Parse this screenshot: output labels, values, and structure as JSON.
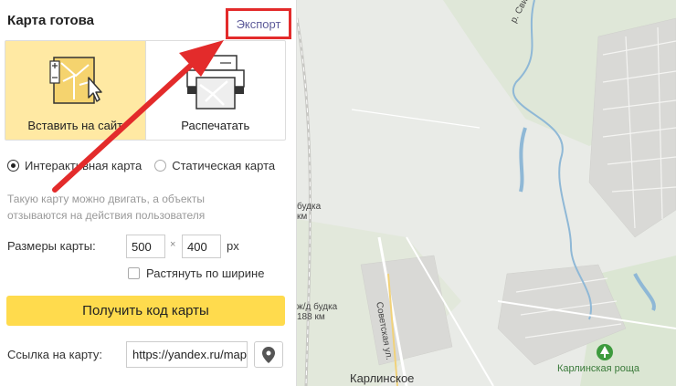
{
  "panel": {
    "title": "Карта готова",
    "export_label": "Экспорт",
    "tiles": [
      {
        "label": "Вставить на сайт",
        "icon": "embed-map-cursor-icon",
        "active": true
      },
      {
        "label": "Распечатать",
        "icon": "printer-icon",
        "active": false
      }
    ],
    "map_type": {
      "options": [
        "Интерактивная карта",
        "Статическая карта"
      ],
      "selected": "Интерактивная карта"
    },
    "hint": "Такую карту можно двигать, а объекты отзываются на действия пользователя",
    "size": {
      "label": "Размеры карты:",
      "width": "500",
      "height": "400",
      "separator": "×",
      "unit": "px"
    },
    "stretch_label": "Растянуть по ширине",
    "get_code_label": "Получить код карты",
    "link": {
      "label": "Ссылка на карту:",
      "value": "https://yandex.ru/map"
    }
  },
  "map": {
    "labels": {
      "river": "р. Свияга",
      "budka1_line1": "будка",
      "budka1_line2": "км",
      "budka2_line1": "ж/д будка",
      "budka2_line2": "188 км",
      "street": "Советская ул.",
      "village": "Карлинское",
      "park": "Карлинская роща"
    }
  },
  "colors": {
    "accent_yellow": "#ffdb4d",
    "active_tile": "#ffe9a3",
    "highlight_red": "#e32b2b",
    "link_purple": "#5c5a99"
  }
}
